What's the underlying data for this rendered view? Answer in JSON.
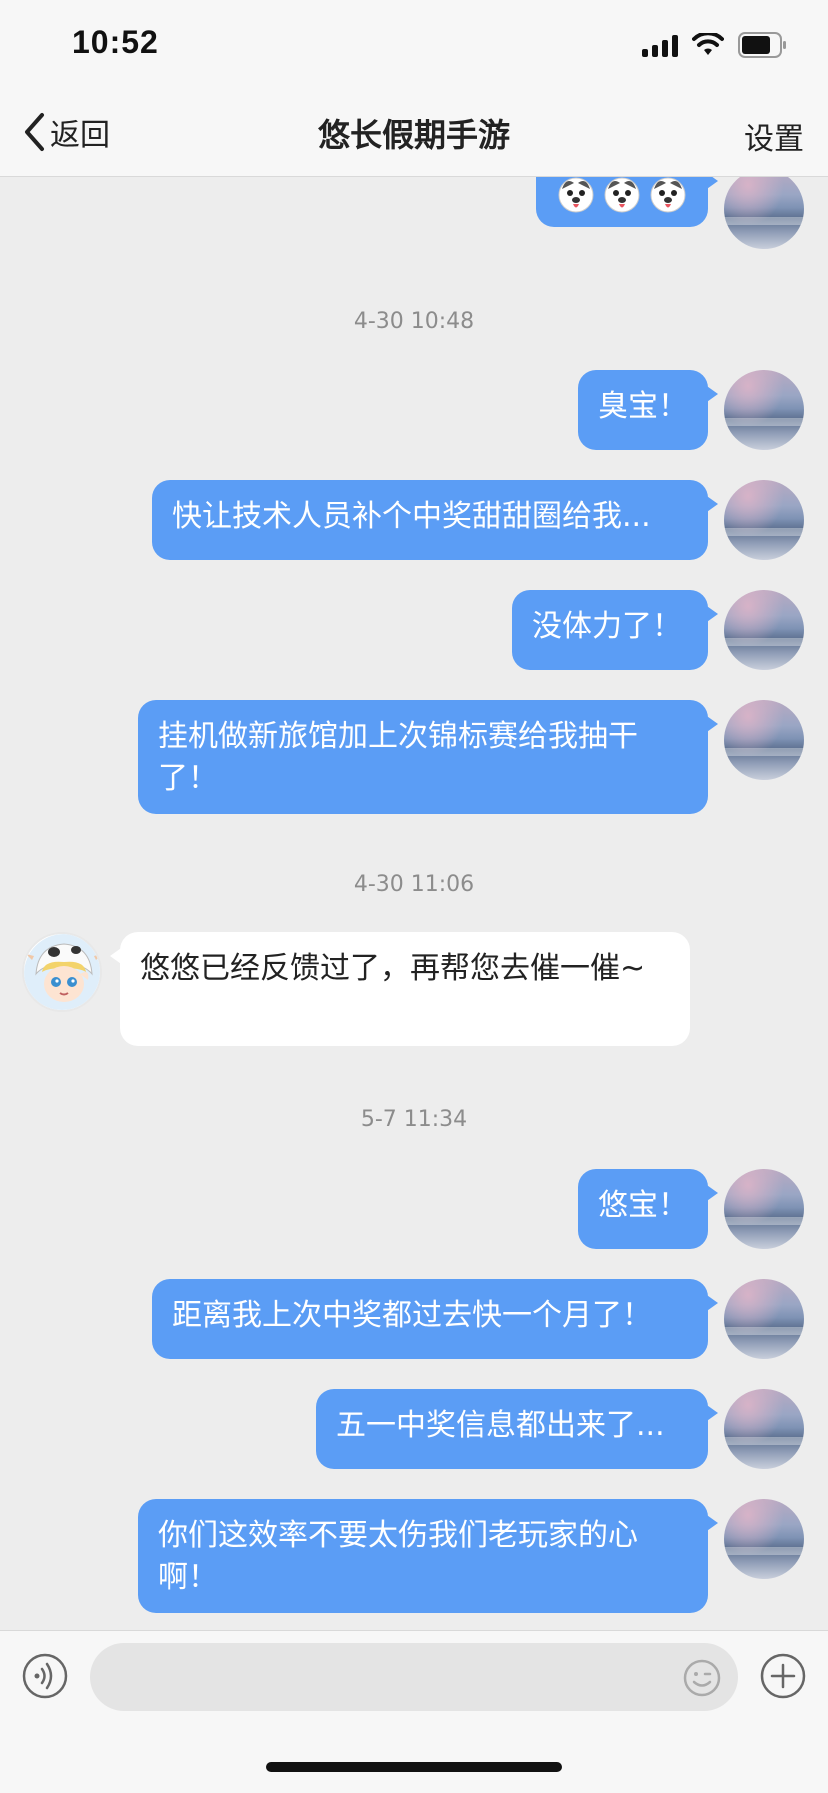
{
  "status_bar": {
    "time": "10:52"
  },
  "nav": {
    "back_label": "返回",
    "title": "悠长假期手游",
    "settings_label": "设置"
  },
  "messages": {
    "m0_emoji": [
      "dog-emoji",
      "dog-emoji",
      "dog-emoji"
    ],
    "ts1": "4-30 10:48",
    "m1": "臭宝！",
    "m2": "快让技术人员补个中奖甜甜圈给我...",
    "m3": "没体力了！",
    "m4": "挂机做新旅馆加上次锦标赛给我抽干了！",
    "ts2": "4-30 11:06",
    "m5": "悠悠已经反馈过了，再帮您去催一催~",
    "ts3": "5-7 11:34",
    "m6": "悠宝！",
    "m7": "距离我上次中奖都过去快一个月了！",
    "m8": "五一中奖信息都出来了...",
    "m9": "你们这效率不要太伤我们老玩家的心啊！"
  },
  "colors": {
    "my_bubble": "#5b9df5",
    "their_bubble": "#ffffff",
    "background": "#ededed"
  }
}
